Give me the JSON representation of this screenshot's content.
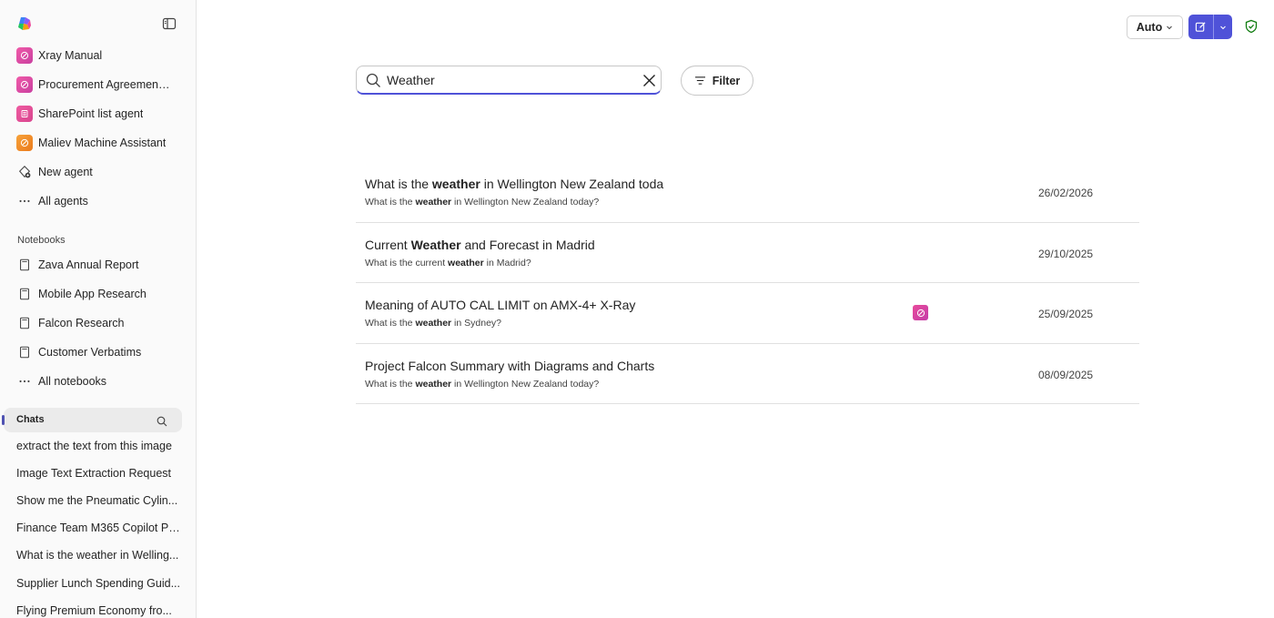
{
  "sidebar": {
    "agents": [
      {
        "label": "Xray Manual",
        "icon": "agent-pink-icon",
        "color": "#e0489a"
      },
      {
        "label": "Procurement Agreement ...",
        "icon": "agent-pink-icon",
        "color": "#e0489a"
      },
      {
        "label": "SharePoint list agent",
        "icon": "sharepoint-list-icon",
        "color": "#d9468f"
      },
      {
        "label": "Maliev Machine Assistant",
        "icon": "agent-orange-icon",
        "color": "#f08a24"
      },
      {
        "label": "New agent",
        "icon": "new-agent-icon"
      },
      {
        "label": "All agents",
        "icon": "more-icon"
      }
    ],
    "notebooks_label": "Notebooks",
    "notebooks": [
      {
        "label": "Zava Annual Report"
      },
      {
        "label": "Mobile App Research"
      },
      {
        "label": "Falcon Research"
      },
      {
        "label": "Customer Verbatims"
      },
      {
        "label": "All notebooks"
      }
    ],
    "chats_label": "Chats",
    "chats": [
      "extract the text from this image",
      "Image Text Extraction Request",
      "Show me the Pneumatic Cylin...",
      "Finance Team M365 Copilot Pr...",
      "What is the weather in Welling...",
      "Supplier Lunch Spending Guid...",
      "Flying Premium Economy fro..."
    ]
  },
  "header": {
    "mode_label": "Auto",
    "accent": "#4f52d8",
    "shield_color": "#107c10"
  },
  "search": {
    "value": "Weather",
    "filter_label": "Filter"
  },
  "results": [
    {
      "title_pre": "What is the ",
      "title_bold": "weather",
      "title_post": " in Wellington New Zealand toda",
      "snippet_pre": "What is the ",
      "snippet_bold": "weather",
      "snippet_post": " in Wellington New Zealand today?",
      "date": "26/02/2026"
    },
    {
      "title_pre": "Current ",
      "title_bold": "Weather",
      "title_post": " and Forecast in Madrid",
      "snippet_pre": "What is the current ",
      "snippet_bold": "weather",
      "snippet_post": " in Madrid?",
      "date": "29/10/2025"
    },
    {
      "title_pre": "Meaning of AUTO CAL LIMIT on AMX-4+ X-Ray",
      "title_bold": "",
      "title_post": "",
      "snippet_pre": "What is the ",
      "snippet_bold": "weather",
      "snippet_post": " in Sydney?",
      "date": "25/09/2025",
      "agent_icon": "agent-pink-icon"
    },
    {
      "title_pre": "Project Falcon Summary with Diagrams and Charts",
      "title_bold": "",
      "title_post": "",
      "snippet_pre": "What is the ",
      "snippet_bold": "weather",
      "snippet_post": " in Wellington New Zealand today?",
      "date": "08/09/2025"
    }
  ]
}
